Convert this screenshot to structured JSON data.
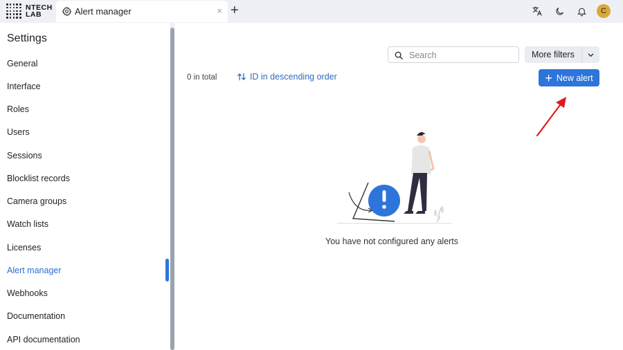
{
  "logo": {
    "line1": "NTECH",
    "line2": "LAB"
  },
  "tab": {
    "title": "Alert manager",
    "icon": "gear-icon",
    "close": "×",
    "add": "+"
  },
  "top_icons": [
    "translate-icon",
    "moon-icon",
    "bell-icon"
  ],
  "user": {
    "initial": "C"
  },
  "sidebar": {
    "title": "Settings",
    "items": [
      {
        "label": "General"
      },
      {
        "label": "Interface"
      },
      {
        "label": "Roles"
      },
      {
        "label": "Users"
      },
      {
        "label": "Sessions"
      },
      {
        "label": "Blocklist records"
      },
      {
        "label": "Camera groups"
      },
      {
        "label": "Watch lists"
      },
      {
        "label": "Licenses"
      },
      {
        "label": "Alert manager",
        "active": true
      },
      {
        "label": "Webhooks"
      },
      {
        "label": "Documentation"
      },
      {
        "label": "API documentation"
      }
    ]
  },
  "toolbar": {
    "search_placeholder": "Search",
    "more_filters": "More filters",
    "total": "0 in total",
    "sort": "ID in descending order",
    "new_alert": "New alert"
  },
  "empty_state": {
    "message": "You have not configured any alerts"
  },
  "colors": {
    "accent": "#2e75db",
    "link": "#2e6dbf",
    "avatar": "#d9a93a",
    "annotation_arrow": "#e01b1b"
  }
}
